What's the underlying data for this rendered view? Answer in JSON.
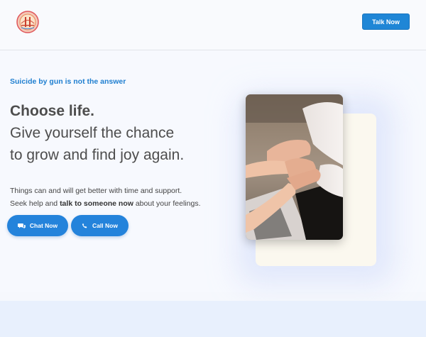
{
  "header": {
    "logo_icon": "golden-gate-bridge-seal-icon",
    "talk_button_label": "Talk Now"
  },
  "hero": {
    "tagline": "Suicide by gun is not the answer",
    "headline_bold": "Choose life.",
    "headline_line2": "Give yourself the chance",
    "headline_line3": "to grow and find joy again.",
    "body_line1": "Things can and will get better with time and support.",
    "body_line2_prefix": "Seek help and ",
    "body_line2_bold": "talk to someone now",
    "body_line2_suffix": " about your feelings.",
    "chat_button_label": "Chat Now",
    "chat_icon": "chat-bubbles-icon",
    "call_button_label": "Call Now",
    "call_icon": "phone-icon",
    "image_subject": "hands-holding-photo"
  },
  "colors": {
    "accent": "#1f86d6",
    "tagline": "#1f7fd0",
    "headline": "#4d4d4d",
    "background": "#f6f8fd"
  }
}
